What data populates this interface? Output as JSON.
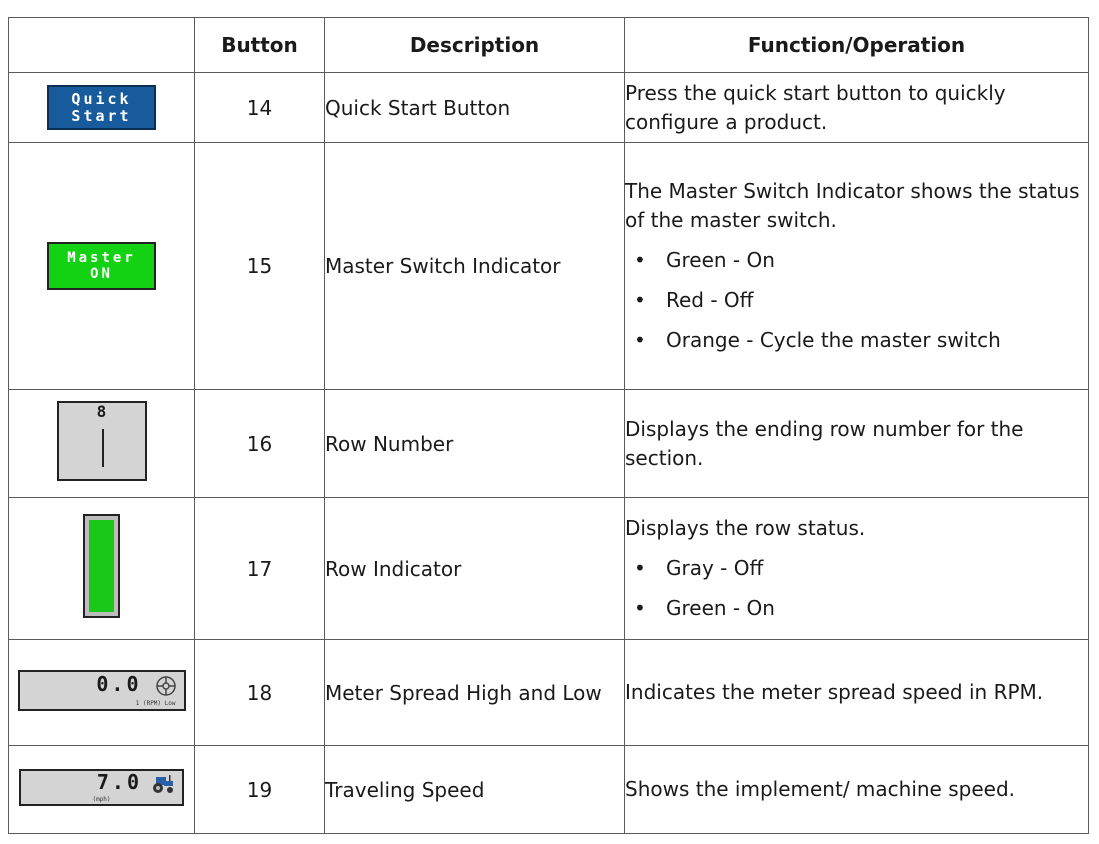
{
  "headers": {
    "icon": "",
    "button": "Button",
    "description": "Description",
    "function": "Function/Operation"
  },
  "rows": [
    {
      "icon_name": "quick-start-button-icon",
      "icon_text": [
        "Quick",
        "Start"
      ],
      "button": "14",
      "description": "Quick Start Button",
      "function": "Press the quick start button to quickly configure a product.",
      "bullets": []
    },
    {
      "icon_name": "master-switch-indicator-icon",
      "icon_text": [
        "Master",
        "ON"
      ],
      "button": "15",
      "description": "Master Switch Indicator",
      "function": "The Master Switch Indicator shows the status of the master switch.",
      "bullets": [
        "Green - On",
        "Red - Off",
        "Orange - Cycle the master switch"
      ]
    },
    {
      "icon_name": "row-number-icon",
      "icon_text": [
        "8"
      ],
      "button": "16",
      "description": "Row Number",
      "function": "Displays the ending row number for the section.",
      "bullets": []
    },
    {
      "icon_name": "row-indicator-icon",
      "icon_text": [],
      "button": "17",
      "description": "Row Indicator",
      "function": "Displays the row status.",
      "bullets": [
        "Gray - Off",
        "Green - On"
      ]
    },
    {
      "icon_name": "meter-spread-icon",
      "icon_text": [
        "0.0",
        "1 (RPM) Low"
      ],
      "button": "18",
      "description": "Meter Spread High and Low",
      "function": "Indicates the meter spread speed in RPM.",
      "bullets": []
    },
    {
      "icon_name": "traveling-speed-icon",
      "icon_text": [
        "7.0",
        "(mph)"
      ],
      "button": "19",
      "description": "Traveling Speed",
      "function": "Shows the implement/ machine speed.",
      "bullets": []
    }
  ],
  "colors": {
    "quick_start_bg": "#185b9c",
    "master_on_bg": "#13d213",
    "row_indicator_on": "#19c819",
    "display_bg": "#d4d4d4"
  }
}
